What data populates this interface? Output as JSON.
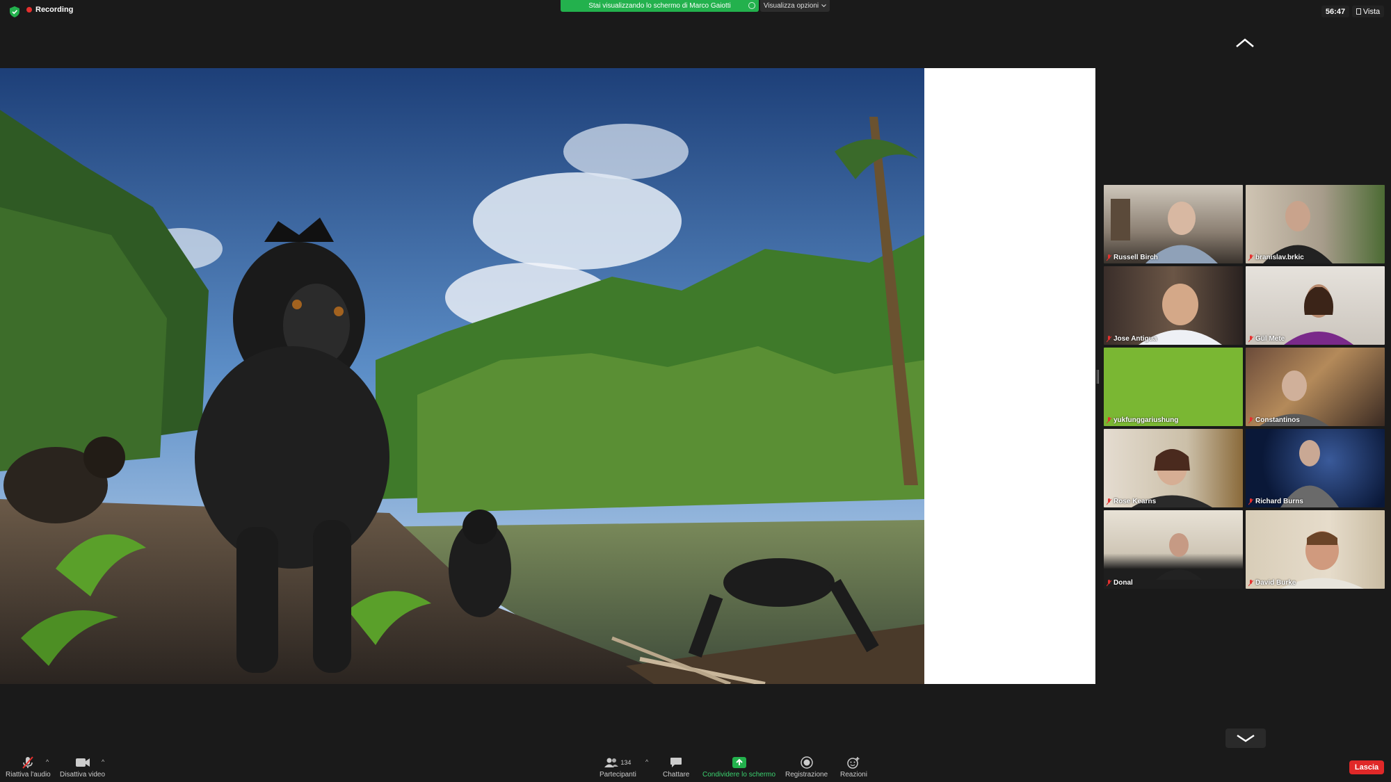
{
  "topbar": {
    "recording_label": "Recording",
    "share_banner": "Stai visualizzando lo schermo di Marco Gaiotti",
    "view_options": "Visualizza opzioni",
    "timer": "56:47",
    "view_label": "Vista"
  },
  "gallery": {
    "participants": [
      {
        "name": "Russell Birch"
      },
      {
        "name": "branislav.brkic"
      },
      {
        "name": "Jose Antigua"
      },
      {
        "name": "Gül Mete"
      },
      {
        "name": "yukfunggariushung"
      },
      {
        "name": "Constantinos"
      },
      {
        "name": "Rose Kearns"
      },
      {
        "name": "Richard Burns"
      },
      {
        "name": "Donal"
      },
      {
        "name": "David Burke"
      }
    ]
  },
  "toolbar": {
    "unmute_label": "Riattiva l'audio",
    "video_label": "Disattiva video",
    "participants_label": "Partecipanti",
    "participants_count": "134",
    "chat_label": "Chattare",
    "share_label": "Condividere lo schermo",
    "record_label": "Registrazione",
    "reactions_label": "Reazioni",
    "leave_label": "Lascia"
  },
  "colors": {
    "accent_green": "#23b14d",
    "leave_red": "#e02828",
    "recording_red": "#e5302e"
  }
}
